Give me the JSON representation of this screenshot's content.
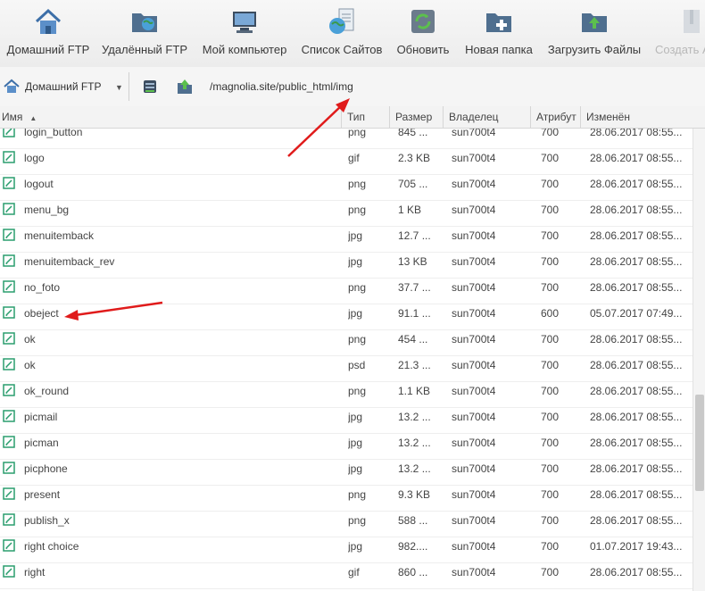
{
  "toolbar": {
    "buttons": [
      {
        "label": "Домашний FTP",
        "icon": "home-icon"
      },
      {
        "label": "Удалённый FTP",
        "icon": "remote-folder-icon"
      },
      {
        "label": "Мой компьютер",
        "icon": "computer-icon"
      },
      {
        "label": "Список Сайтов",
        "icon": "site-list-icon"
      },
      {
        "label": "Обновить",
        "icon": "refresh-icon"
      },
      {
        "label": "Новая папка",
        "icon": "new-folder-icon"
      },
      {
        "label": "Загрузить Файлы",
        "icon": "upload-icon"
      },
      {
        "label": "Создать А",
        "icon": "archive-icon"
      }
    ]
  },
  "pathbar": {
    "site": "Домашний FTP",
    "path": "/magnolia.site/public_html/img"
  },
  "columns": {
    "name": "Имя",
    "type": "Тип",
    "size": "Размер",
    "owner": "Владелец",
    "attr": "Атрибут",
    "modified": "Изменён"
  },
  "files": [
    {
      "name": "login_button",
      "type": "png",
      "size": "845 ...",
      "owner": "sun700t4",
      "attr": "700",
      "modified": "28.06.2017 08:55..."
    },
    {
      "name": "logo",
      "type": "gif",
      "size": "2.3 KB",
      "owner": "sun700t4",
      "attr": "700",
      "modified": "28.06.2017 08:55..."
    },
    {
      "name": "logout",
      "type": "png",
      "size": "705 ...",
      "owner": "sun700t4",
      "attr": "700",
      "modified": "28.06.2017 08:55..."
    },
    {
      "name": "menu_bg",
      "type": "png",
      "size": "1 KB",
      "owner": "sun700t4",
      "attr": "700",
      "modified": "28.06.2017 08:55..."
    },
    {
      "name": "menuitemback",
      "type": "jpg",
      "size": "12.7 ...",
      "owner": "sun700t4",
      "attr": "700",
      "modified": "28.06.2017 08:55..."
    },
    {
      "name": "menuitemback_rev",
      "type": "jpg",
      "size": "13 KB",
      "owner": "sun700t4",
      "attr": "700",
      "modified": "28.06.2017 08:55..."
    },
    {
      "name": "no_foto",
      "type": "png",
      "size": "37.7 ...",
      "owner": "sun700t4",
      "attr": "700",
      "modified": "28.06.2017 08:55..."
    },
    {
      "name": "obeject",
      "type": "jpg",
      "size": "91.1 ...",
      "owner": "sun700t4",
      "attr": "600",
      "modified": "05.07.2017 07:49..."
    },
    {
      "name": "ok",
      "type": "png",
      "size": "454 ...",
      "owner": "sun700t4",
      "attr": "700",
      "modified": "28.06.2017 08:55..."
    },
    {
      "name": "ok",
      "type": "psd",
      "size": "21.3 ...",
      "owner": "sun700t4",
      "attr": "700",
      "modified": "28.06.2017 08:55..."
    },
    {
      "name": "ok_round",
      "type": "png",
      "size": "1.1 KB",
      "owner": "sun700t4",
      "attr": "700",
      "modified": "28.06.2017 08:55..."
    },
    {
      "name": "picmail",
      "type": "jpg",
      "size": "13.2 ...",
      "owner": "sun700t4",
      "attr": "700",
      "modified": "28.06.2017 08:55..."
    },
    {
      "name": "picman",
      "type": "jpg",
      "size": "13.2 ...",
      "owner": "sun700t4",
      "attr": "700",
      "modified": "28.06.2017 08:55..."
    },
    {
      "name": "picphone",
      "type": "jpg",
      "size": "13.2 ...",
      "owner": "sun700t4",
      "attr": "700",
      "modified": "28.06.2017 08:55..."
    },
    {
      "name": "present",
      "type": "png",
      "size": "9.3 KB",
      "owner": "sun700t4",
      "attr": "700",
      "modified": "28.06.2017 08:55..."
    },
    {
      "name": "publish_x",
      "type": "png",
      "size": "588 ...",
      "owner": "sun700t4",
      "attr": "700",
      "modified": "28.06.2017 08:55..."
    },
    {
      "name": "right choice",
      "type": "jpg",
      "size": "982....",
      "owner": "sun700t4",
      "attr": "700",
      "modified": "01.07.2017 19:43..."
    },
    {
      "name": "right",
      "type": "gif",
      "size": "860 ...",
      "owner": "sun700t4",
      "attr": "700",
      "modified": "28.06.2017 08:55..."
    }
  ],
  "colors": {
    "accent_green": "#2a9d6e",
    "annotation_red": "#e01b1b"
  }
}
